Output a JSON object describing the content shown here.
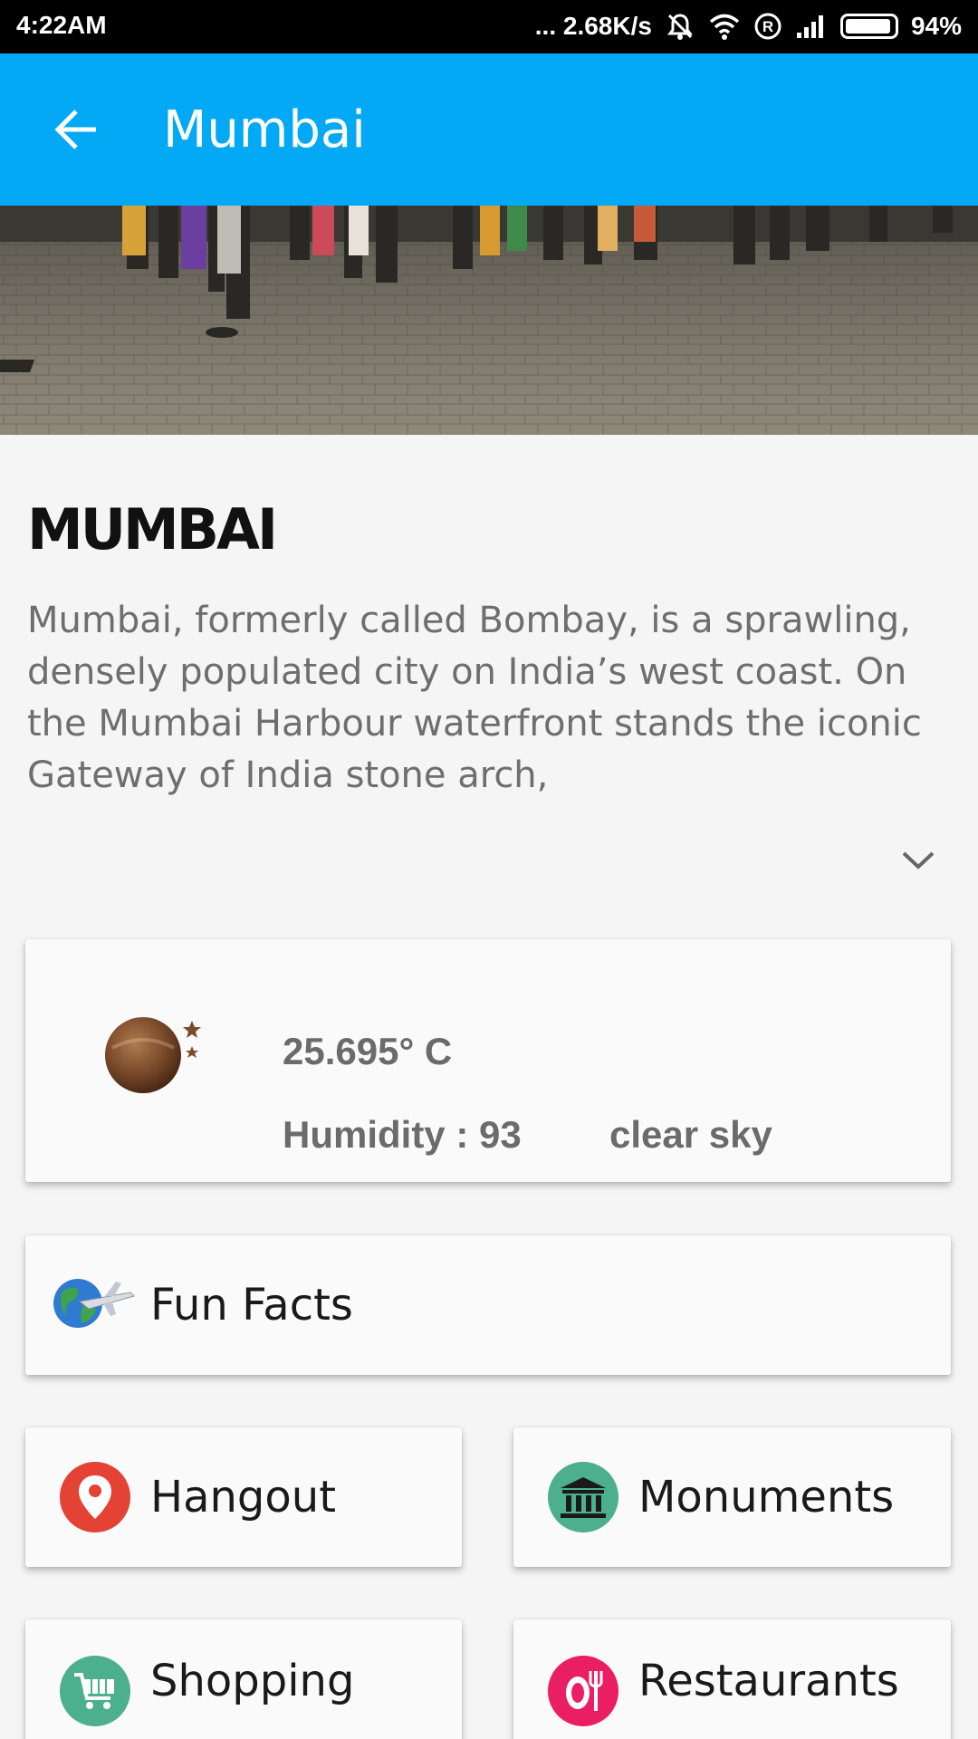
{
  "status_bar": {
    "time": "4:22AM",
    "network_speed": "... 2.68K/s",
    "battery_percent": "94%",
    "battery_level": 0.94,
    "icons": [
      "mute-icon",
      "wifi-icon",
      "roaming-icon",
      "signal-icon",
      "battery-icon"
    ]
  },
  "toolbar": {
    "title": "Mumbai",
    "back_icon": "arrow-back-icon",
    "color": "#03a9f4"
  },
  "hero": {
    "image": "crowd-on-plaza-photo"
  },
  "city": {
    "name": "MUMBAI",
    "description": "Mumbai, formerly called Bombay, is a sprawling, densely populated city on India’s west coast. On the Mumbai Harbour waterfront stands the iconic Gateway of India stone arch,",
    "expand_icon": "chevron-down-icon"
  },
  "weather": {
    "temperature": "25.695° C",
    "humidity": "Humidity : 93",
    "condition": "clear sky",
    "icon": "night-moon-icon"
  },
  "tiles": {
    "fun_facts": {
      "label": "Fun Facts",
      "icon": "globe-plane-icon"
    },
    "hangout": {
      "label": "Hangout",
      "icon": "location-pin-icon",
      "color": "#e34234"
    },
    "monuments": {
      "label": "Monuments",
      "icon": "museum-icon",
      "color": "#4caf8e"
    },
    "shopping": {
      "label": "Shopping",
      "icon": "shopping-cart-icon",
      "color": "#4caf8e"
    },
    "restaurants": {
      "label": "Restaurants",
      "icon": "fork-plate-icon",
      "color": "#e91e63"
    }
  }
}
